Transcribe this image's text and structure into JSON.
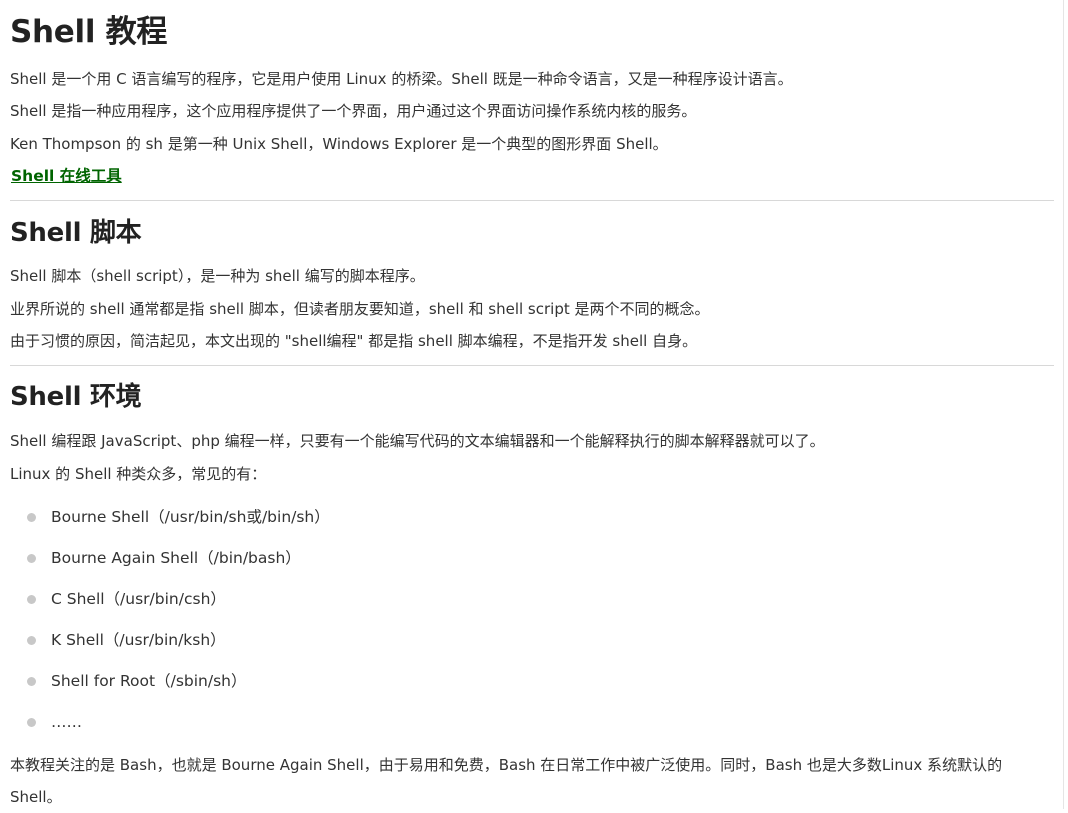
{
  "title": "Shell 教程",
  "intro": [
    "Shell 是一个用 C 语言编写的程序，它是用户使用 Linux 的桥梁。Shell 既是一种命令语言，又是一种程序设计语言。",
    "Shell 是指一种应用程序，这个应用程序提供了一个界面，用户通过这个界面访问操作系统内核的服务。",
    "Ken Thompson 的 sh 是第一种 Unix Shell，Windows Explorer 是一个典型的图形界面 Shell。"
  ],
  "online_tool_link": "Shell 在线工具",
  "section_script": {
    "heading": "Shell 脚本",
    "paragraphs": [
      "Shell 脚本（shell script），是一种为 shell 编写的脚本程序。",
      "业界所说的 shell 通常都是指 shell 脚本，但读者朋友要知道，shell 和 shell script 是两个不同的概念。",
      "由于习惯的原因，简洁起见，本文出现的 \"shell编程\" 都是指 shell 脚本编程，不是指开发 shell 自身。"
    ]
  },
  "section_env": {
    "heading": "Shell 环境",
    "paragraphs": [
      "Shell 编程跟 JavaScript、php 编程一样，只要有一个能编写代码的文本编辑器和一个能解释执行的脚本解释器就可以了。",
      "Linux 的 Shell 种类众多，常见的有："
    ],
    "list": [
      "Bourne Shell（/usr/bin/sh或/bin/sh）",
      "Bourne Again Shell（/bin/bash）",
      "C Shell（/usr/bin/csh）",
      "K Shell（/usr/bin/ksh）",
      "Shell for Root（/sbin/sh）",
      "……"
    ],
    "closing": "本教程关注的是 Bash，也就是 Bourne Again Shell，由于易用和免费，Bash 在日常工作中被广泛使用。同时，Bash 也是大多数Linux 系统默认的 Shell。"
  }
}
